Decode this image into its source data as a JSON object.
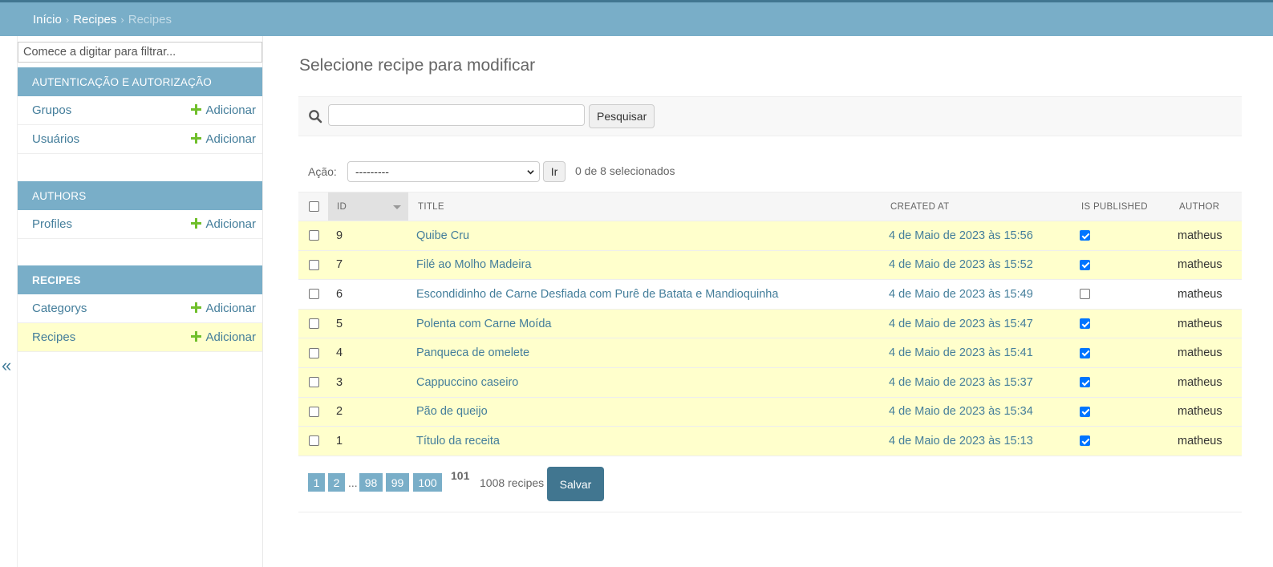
{
  "breadcrumbs": {
    "home": "Início",
    "app": "Recipes",
    "current": "Recipes",
    "separator": "›"
  },
  "sidebar": {
    "filter_placeholder": "Comece a digitar para filtrar...",
    "toggle_label": "«",
    "modules": [
      {
        "caption": "AUTENTICAÇÃO E AUTORIZAÇÃO",
        "models": [
          {
            "label": "Grupos",
            "add": "Adicionar"
          },
          {
            "label": "Usuários",
            "add": "Adicionar"
          }
        ]
      },
      {
        "caption": "AUTHORS",
        "models": [
          {
            "label": "Profiles",
            "add": "Adicionar"
          }
        ]
      },
      {
        "caption": "RECIPES",
        "models": [
          {
            "label": "Categorys",
            "add": "Adicionar"
          },
          {
            "label": "Recipes",
            "add": "Adicionar"
          }
        ]
      }
    ]
  },
  "page": {
    "title": "Selecione recipe para modificar"
  },
  "search": {
    "value": "",
    "button": "Pesquisar"
  },
  "actions": {
    "label": "Ação:",
    "selected": "---------",
    "go": "Ir",
    "counter": "0 de 8 selecionados"
  },
  "table": {
    "headers": {
      "id": "ID",
      "title": "TITLE",
      "created_at": "CREATED AT",
      "is_published": "IS PUBLISHED",
      "author": "AUTHOR"
    },
    "rows": [
      {
        "id": "9",
        "title": "Quibe Cru",
        "created_at": "4 de Maio de 2023 às 15:56",
        "is_published": true,
        "author": "matheus"
      },
      {
        "id": "7",
        "title": "Filé ao Molho Madeira",
        "created_at": "4 de Maio de 2023 às 15:52",
        "is_published": true,
        "author": "matheus"
      },
      {
        "id": "6",
        "title": "Escondidinho de Carne Desfiada com Purê de Batata e Mandioquinha",
        "created_at": "4 de Maio de 2023 às 15:49",
        "is_published": false,
        "author": "matheus"
      },
      {
        "id": "5",
        "title": "Polenta com Carne Moída",
        "created_at": "4 de Maio de 2023 às 15:47",
        "is_published": true,
        "author": "matheus"
      },
      {
        "id": "4",
        "title": "Panqueca de omelete",
        "created_at": "4 de Maio de 2023 às 15:41",
        "is_published": true,
        "author": "matheus"
      },
      {
        "id": "3",
        "title": "Cappuccino caseiro",
        "created_at": "4 de Maio de 2023 às 15:37",
        "is_published": true,
        "author": "matheus"
      },
      {
        "id": "2",
        "title": "Pão de queijo",
        "created_at": "4 de Maio de 2023 às 15:34",
        "is_published": true,
        "author": "matheus"
      },
      {
        "id": "1",
        "title": "Título da receita",
        "created_at": "4 de Maio de 2023 às 15:13",
        "is_published": true,
        "author": "matheus"
      }
    ]
  },
  "paginator": {
    "pages": [
      "1",
      "2",
      "98",
      "99",
      "100"
    ],
    "ellipsis": "...",
    "current": "101",
    "count": "1008 recipes",
    "save": "Salvar"
  },
  "colors": {
    "header_bg": "#79aec8",
    "top_line": "#417690",
    "link": "#447e9b",
    "row_highlight": "#ffffcc",
    "add_icon": "#70bf2b",
    "save_button": "#417690"
  }
}
